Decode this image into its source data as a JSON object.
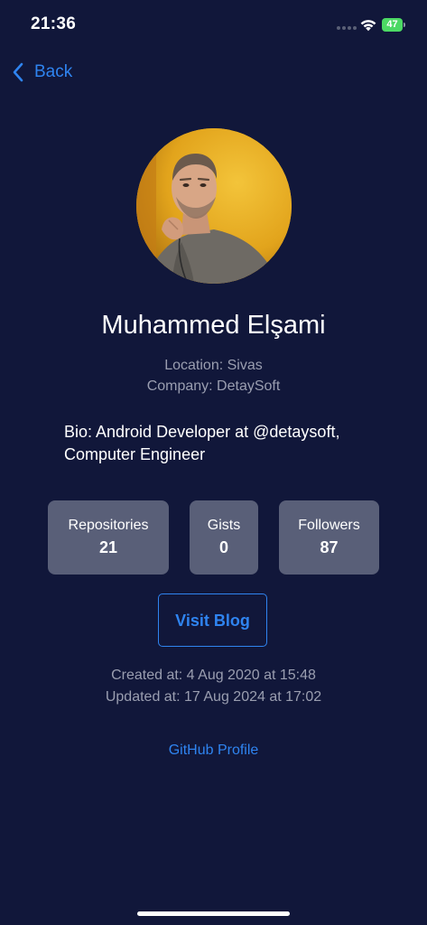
{
  "status_bar": {
    "time": "21:36",
    "battery_level": "47"
  },
  "nav": {
    "back_label": "Back"
  },
  "profile": {
    "name": "Muhammed Elşami",
    "location": "Location: Sivas",
    "company": "Company: DetaySoft",
    "bio": "Bio: Android Developer at @detaysoft, Computer Engineer"
  },
  "stats": [
    {
      "label": "Repositories",
      "value": "21"
    },
    {
      "label": "Gists",
      "value": "0"
    },
    {
      "label": "Followers",
      "value": "87"
    }
  ],
  "actions": {
    "visit_blog_label": "Visit Blog",
    "github_profile_label": "GitHub Profile"
  },
  "dates": {
    "created": "Created at: 4 Aug 2020 at 15:48",
    "updated": "Updated at: 17 Aug 2024 at 17:02"
  },
  "colors": {
    "background": "#11173a",
    "accent": "#2f84f0",
    "card": "#595f78",
    "muted_text": "#9a9eb0",
    "battery": "#4cd964"
  },
  "icons": {
    "back": "chevron-left-icon",
    "wifi": "wifi-icon",
    "signal": "cellular-signal-icon",
    "battery": "battery-icon"
  }
}
